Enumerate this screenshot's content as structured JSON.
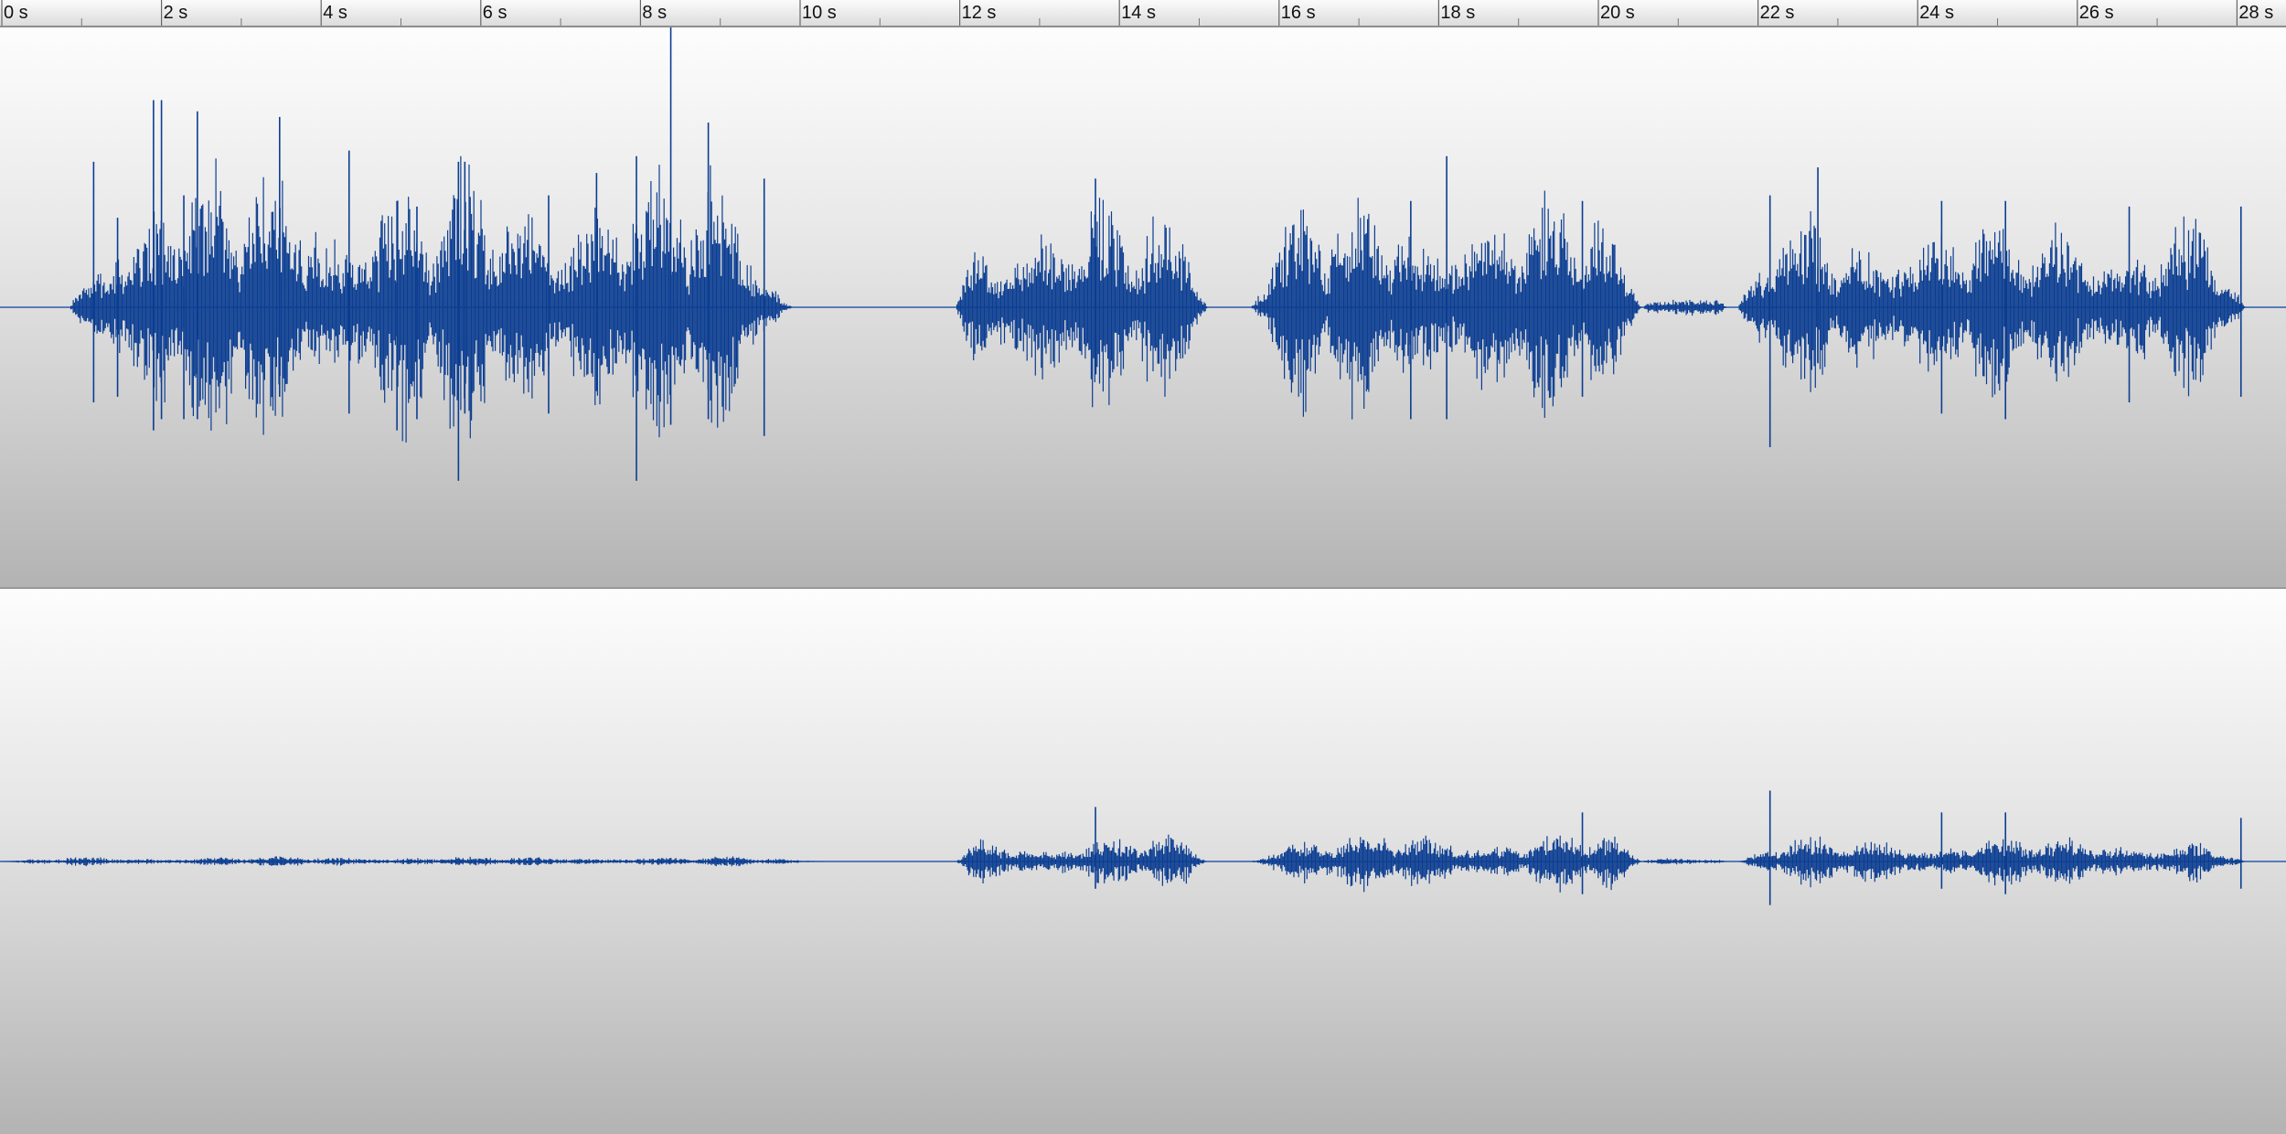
{
  "ruler": {
    "unit_suffix": " s",
    "ticks": [
      {
        "t": 0,
        "label": "0 s"
      },
      {
        "t": 2,
        "label": "2 s"
      },
      {
        "t": 4,
        "label": "4 s"
      },
      {
        "t": 6,
        "label": "6 s"
      },
      {
        "t": 8,
        "label": "8 s"
      },
      {
        "t": 10,
        "label": "10 s"
      },
      {
        "t": 12,
        "label": "12 s"
      },
      {
        "t": 14,
        "label": "14 s"
      },
      {
        "t": 16,
        "label": "16 s"
      },
      {
        "t": 18,
        "label": "18 s"
      },
      {
        "t": 20,
        "label": "20 s"
      },
      {
        "t": 22,
        "label": "22 s"
      },
      {
        "t": 24,
        "label": "24 s"
      },
      {
        "t": 26,
        "label": "26 s"
      },
      {
        "t": 28,
        "label": "28 s"
      }
    ],
    "visible_range_s": [
      0,
      28.6
    ]
  },
  "colors": {
    "waveform": "#0b3d91",
    "center_line": "#2c5aa8"
  },
  "tracks": [
    {
      "id": "channel-1",
      "activity": [
        {
          "start": 0.85,
          "end": 9.9,
          "level": 0.28
        },
        {
          "start": 11.95,
          "end": 15.1,
          "level": 0.2
        },
        {
          "start": 15.65,
          "end": 20.55,
          "level": 0.22
        },
        {
          "start": 20.55,
          "end": 21.6,
          "level": 0.03
        },
        {
          "start": 21.75,
          "end": 28.1,
          "level": 0.18
        }
      ],
      "spikes": [
        {
          "t": 1.15,
          "up": 0.26,
          "down": 0.17
        },
        {
          "t": 1.45,
          "up": 0.16,
          "down": 0.16
        },
        {
          "t": 1.9,
          "up": 0.37,
          "down": 0.22
        },
        {
          "t": 2.0,
          "up": 0.37,
          "down": 0.2
        },
        {
          "t": 2.28,
          "up": 0.2,
          "down": 0.2
        },
        {
          "t": 2.45,
          "up": 0.35,
          "down": 0.2
        },
        {
          "t": 3.48,
          "up": 0.34,
          "down": 0.16
        },
        {
          "t": 4.35,
          "up": 0.28,
          "down": 0.19
        },
        {
          "t": 4.95,
          "up": 0.19,
          "down": 0.22
        },
        {
          "t": 5.2,
          "up": 0.18,
          "down": 0.2
        },
        {
          "t": 5.72,
          "up": 0.26,
          "down": 0.31
        },
        {
          "t": 5.8,
          "up": 0.26,
          "down": 0.19
        },
        {
          "t": 6.85,
          "up": 0.2,
          "down": 0.19
        },
        {
          "t": 7.45,
          "up": 0.24,
          "down": 0.15
        },
        {
          "t": 7.95,
          "up": 0.27,
          "down": 0.31
        },
        {
          "t": 8.38,
          "up": 0.58,
          "down": 0.21
        },
        {
          "t": 8.85,
          "up": 0.33,
          "down": 0.2
        },
        {
          "t": 9.55,
          "up": 0.23,
          "down": 0.23
        },
        {
          "t": 13.7,
          "up": 0.23,
          "down": 0.12
        },
        {
          "t": 18.1,
          "up": 0.27,
          "down": 0.2
        },
        {
          "t": 17.65,
          "up": 0.19,
          "down": 0.2
        },
        {
          "t": 19.8,
          "up": 0.19,
          "down": 0.16
        },
        {
          "t": 22.15,
          "up": 0.2,
          "down": 0.25
        },
        {
          "t": 22.75,
          "up": 0.25,
          "down": 0.1
        },
        {
          "t": 24.3,
          "up": 0.19,
          "down": 0.19
        },
        {
          "t": 25.1,
          "up": 0.19,
          "down": 0.2
        },
        {
          "t": 26.65,
          "up": 0.18,
          "down": 0.17
        },
        {
          "t": 28.05,
          "up": 0.18,
          "down": 0.16
        }
      ]
    },
    {
      "id": "channel-2",
      "activity": [
        {
          "start": 0.0,
          "end": 10.35,
          "level": 0.01
        },
        {
          "start": 11.95,
          "end": 15.1,
          "level": 0.05
        },
        {
          "start": 15.65,
          "end": 20.55,
          "level": 0.06
        },
        {
          "start": 20.55,
          "end": 21.6,
          "level": 0.01
        },
        {
          "start": 21.75,
          "end": 28.1,
          "level": 0.05
        }
      ],
      "spikes": [
        {
          "t": 13.7,
          "up": 0.1,
          "down": 0.05
        },
        {
          "t": 19.8,
          "up": 0.09,
          "down": 0.06
        },
        {
          "t": 22.15,
          "up": 0.13,
          "down": 0.08
        },
        {
          "t": 24.3,
          "up": 0.09,
          "down": 0.05
        },
        {
          "t": 25.1,
          "up": 0.09,
          "down": 0.06
        },
        {
          "t": 28.05,
          "up": 0.08,
          "down": 0.05
        }
      ]
    }
  ]
}
